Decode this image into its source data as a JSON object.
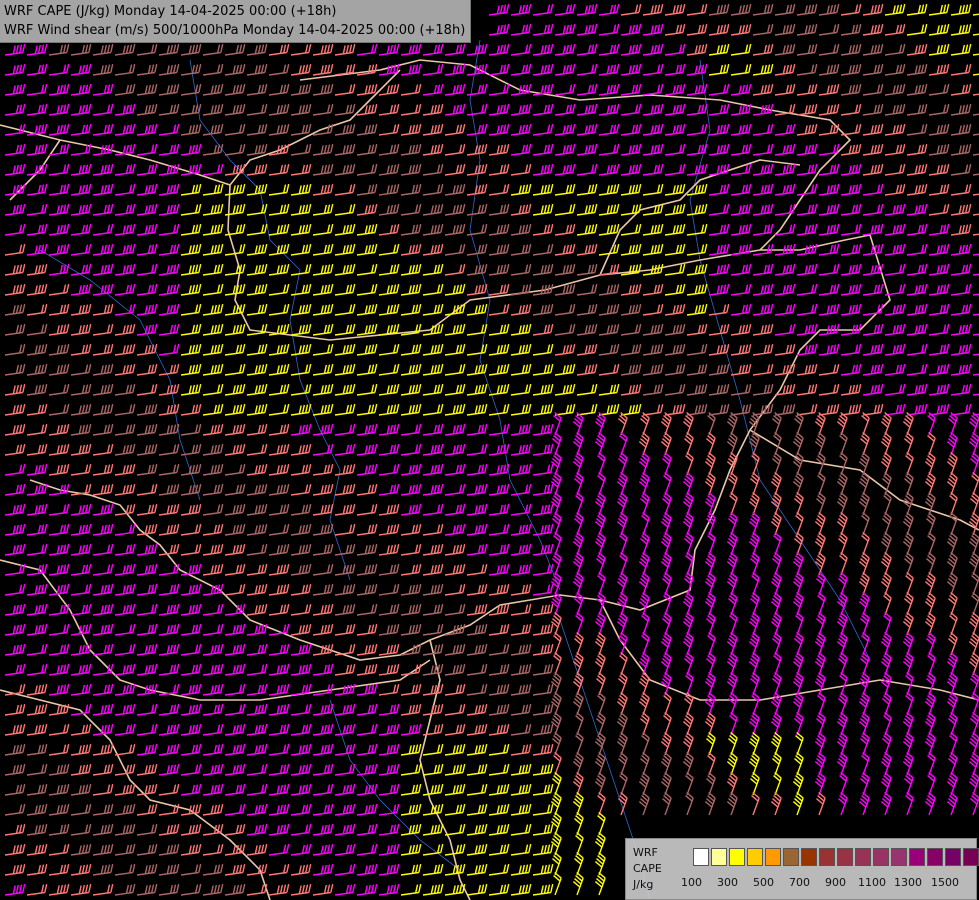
{
  "title": {
    "line1": "WRF CAPE (J/kg) Monday 14-04-2025 00:00 (+18h)",
    "line2": "WRF Wind shear (m/s) 500/1000hPa Monday 14-04-2025 00:00 (+18h)"
  },
  "legend": {
    "label_lines": [
      "WRF",
      "CAPE",
      "J/kg"
    ],
    "tick_labels": [
      "100",
      "300",
      "500",
      "700",
      "900",
      "1100",
      "1300",
      "1500"
    ],
    "colors": [
      "#ffffff",
      "#ffff99",
      "#ffff00",
      "#ffcc00",
      "#ff9900",
      "#996633",
      "#993300",
      "#993333",
      "#993344",
      "#993355",
      "#993366",
      "#99336f",
      "#990077",
      "#880066",
      "#770066",
      "#770055"
    ]
  },
  "map_colors": {
    "background": "#000000",
    "border": "#e8c7a8",
    "river": "#3366cc",
    "barb_low": "#ff7777",
    "barb_mid": "#ff00ff",
    "barb_high": "#ffff00",
    "barb_dim": "#aa6666"
  }
}
